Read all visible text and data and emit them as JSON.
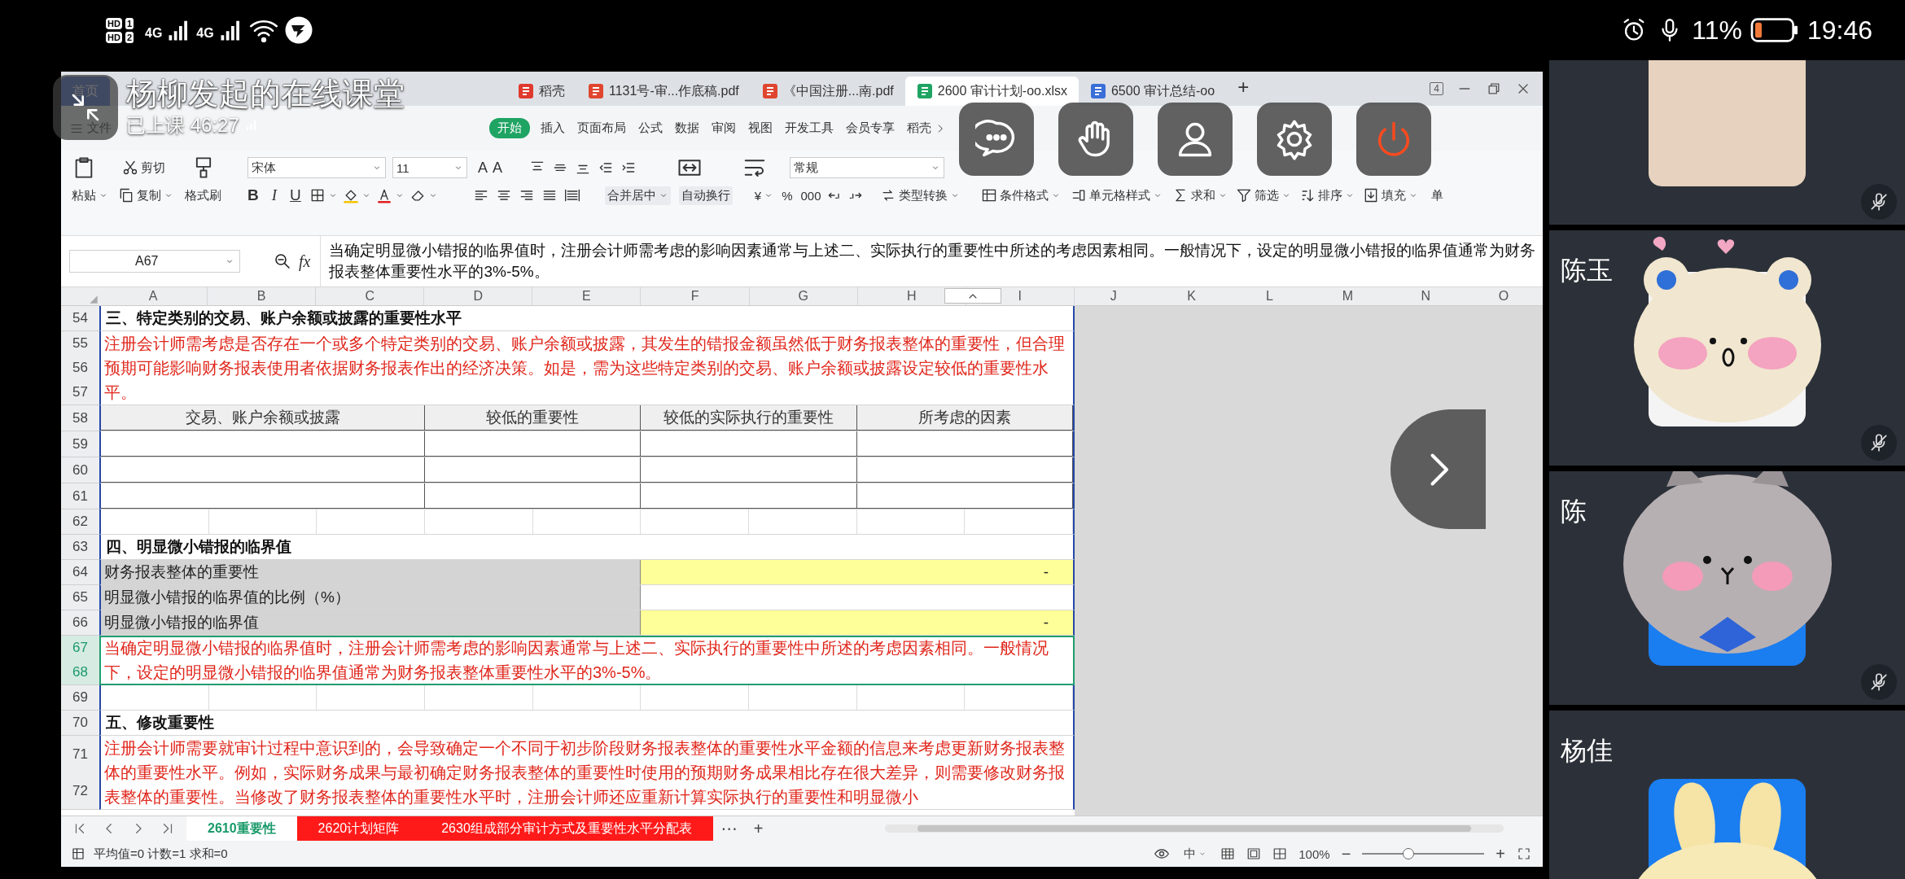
{
  "phone_status": {
    "sims": [
      {
        "label": "HD",
        "slot": "1"
      },
      {
        "label": "HD",
        "slot": "2"
      }
    ],
    "networks": [
      {
        "label": "4G"
      },
      {
        "label": "4G"
      }
    ],
    "battery": "11%",
    "time": "19:46"
  },
  "class_overlay": {
    "title": "杨柳发起的在线课堂",
    "timer": "已上课 46:27"
  },
  "overlay_buttons": [
    {
      "kind": "chat"
    },
    {
      "kind": "raise_hand"
    },
    {
      "kind": "profile"
    },
    {
      "kind": "settings"
    },
    {
      "kind": "leave"
    }
  ],
  "app_tabs": [
    {
      "label": "首页",
      "kind": "home",
      "selected": false
    },
    {
      "label": "稻壳",
      "kind": "docer",
      "selected": false
    },
    {
      "label": "1131号-审...作底稿.pdf",
      "kind": "pdf",
      "selected": false
    },
    {
      "label": "《中国注册...南.pdf",
      "kind": "pdf",
      "selected": false
    },
    {
      "label": "2600 审计计划-oo.xlsx",
      "kind": "sheet",
      "selected": true
    },
    {
      "label": "6500 审计总结-oo",
      "kind": "doc",
      "selected": false
    }
  ],
  "new_tab": "+",
  "window_count": "4",
  "menu": [
    {
      "label": "文件",
      "kind": "file",
      "selected": false
    },
    {
      "label": "开始",
      "kind": "tab",
      "selected": true
    },
    {
      "label": "插入",
      "kind": "tab",
      "selected": false
    },
    {
      "label": "页面布局",
      "kind": "tab",
      "selected": false
    },
    {
      "label": "公式",
      "kind": "tab",
      "selected": false
    },
    {
      "label": "数据",
      "kind": "tab",
      "selected": false
    },
    {
      "label": "审阅",
      "kind": "tab",
      "selected": false
    },
    {
      "label": "视图",
      "kind": "tab",
      "selected": false
    },
    {
      "label": "开发工具",
      "kind": "tab",
      "selected": false
    },
    {
      "label": "会员专享",
      "kind": "tab",
      "selected": false
    },
    {
      "label": "稻壳",
      "kind": "more",
      "selected": false
    }
  ],
  "ribbon": {
    "cut": "剪切",
    "paste": "粘贴",
    "copy": "复制",
    "format_painter": "格式刷",
    "font": "宋体",
    "font_size": "11",
    "grow_font": "A",
    "shrink_font": "A",
    "bold": "B",
    "italic": "I",
    "underline": "U",
    "merge": "合并居中",
    "wrap": "自动换行",
    "number_format": "常规",
    "currency": "¥",
    "percent": "%",
    "thousands": "000",
    "convert": "类型转换",
    "conditional": "条件格式",
    "cell_style": "单元格样式",
    "sum": "求和",
    "filter": "筛选",
    "sort": "排序",
    "fill": "填充",
    "overflow": "单"
  },
  "formula_bar": {
    "cell": "A67",
    "fx": "fx",
    "formula": "当确定明显微小错报的临界值时，注册会计师需考虑的影响因素通常与上述二、实际执行的重要性中所述的考虑因素相同。一般情况下，设定的明显微小错报的临界值通常为财务报表整体重要性水平的3%-5%。"
  },
  "sheet": {
    "columns": [
      "A",
      "B",
      "C",
      "D",
      "E",
      "F",
      "G",
      "H",
      "I"
    ],
    "extra_columns": [
      "J",
      "K",
      "L",
      "M",
      "N",
      "O"
    ],
    "rows": [
      {
        "kind": "heading",
        "numbers": [
          "54"
        ],
        "selected": false,
        "text": "三、特定类别的交易、账户余额或披露的重要性水平"
      },
      {
        "kind": "note",
        "numbers": [
          "55",
          "56",
          "57"
        ],
        "selected": false,
        "text": "注册会计师需考虑是否存在一个或多个特定类别的交易、账户余额或披露，其发生的错报金额虽然低于财务报表整体的重要性，但合理预期可能影响财务报表使用者依据财务报表作出的经济决策。如是，需为这些特定类别的交易、账户余额或披露设定较低的重要性水平。"
      },
      {
        "kind": "table_header",
        "numbers": [
          "58"
        ],
        "selected": false,
        "cells": [
          "交易、账户余额或披露",
          "较低的重要性",
          "较低的实际执行的重要性",
          "所考虑的因素"
        ]
      },
      {
        "kind": "table_row",
        "numbers": [
          "59"
        ],
        "selected": false
      },
      {
        "kind": "table_row",
        "numbers": [
          "60"
        ],
        "selected": false
      },
      {
        "kind": "table_row",
        "numbers": [
          "61"
        ],
        "selected": false
      },
      {
        "kind": "blank",
        "numbers": [
          "62"
        ],
        "selected": false
      },
      {
        "kind": "heading",
        "numbers": [
          "63"
        ],
        "selected": false,
        "text": "四、明显微小错报的临界值"
      },
      {
        "kind": "field",
        "numbers": [
          "64"
        ],
        "selected": false,
        "label": "财务报表整体的重要性",
        "value": "-",
        "highlight": true
      },
      {
        "kind": "field",
        "numbers": [
          "65"
        ],
        "selected": false,
        "label": "明显微小错报的临界值的比例（%）",
        "highlight": false
      },
      {
        "kind": "field",
        "numbers": [
          "66"
        ],
        "selected": false,
        "label": "明显微小错报的临界值",
        "value": "-",
        "highlight": true
      },
      {
        "kind": "note",
        "numbers": [
          "67",
          "68"
        ],
        "selected": true,
        "text": "当确定明显微小错报的临界值时，注册会计师需考虑的影响因素通常与上述二、实际执行的重要性中所述的考虑因素相同。一般情况下，设定的明显微小错报的临界值通常为财务报表整体重要性水平的3%-5%。"
      },
      {
        "kind": "blank",
        "numbers": [
          "69"
        ],
        "selected": false
      },
      {
        "kind": "heading",
        "numbers": [
          "70"
        ],
        "selected": false,
        "text": "五、修改重要性"
      },
      {
        "kind": "note",
        "numbers": [
          "71",
          "72"
        ],
        "selected": false,
        "text": "注册会计师需要就审计过程中意识到的，会导致确定一个不同于初步阶段财务报表整体的重要性水平金额的信息来考虑更新财务报表整体的重要性水平。例如，实际财务成果与最初确定财务报表整体的重要性时使用的预期财务成果相比存在很大差异，则需要修改财务报表整体的重要性。当修改了财务报表整体的重要性水平时，注册会计师还应重新计算实际执行的重要性和明显微小"
      }
    ]
  },
  "sheet_tabs": [
    {
      "label": "2610重要性",
      "selected": true
    },
    {
      "label": "2620计划矩阵",
      "selected": false,
      "color": "#ff1a1a"
    },
    {
      "label": "2630组成部分审计方式及重要性水平分配表",
      "selected": false,
      "color": "#ff1a1a"
    }
  ],
  "more_tabs": "⋯",
  "add_sheet": "+",
  "status_bar": {
    "summary": "平均值=0 计数=1 求和=0",
    "ime": "中",
    "zoom": "100%",
    "zoom_out": "−",
    "zoom_in": "+",
    "zoom_slider": {
      "level": 0.38
    }
  },
  "participants": [
    {
      "kind": "photo",
      "muted": true
    },
    {
      "kind": "avatar",
      "name": "陈玉",
      "color": "#f4f4f4",
      "sticker": {
        "kind": "bear"
      },
      "muted": true
    },
    {
      "kind": "avatar",
      "name": "陈",
      "color": "#1a7df0",
      "sticker": {
        "kind": "cat"
      },
      "muted": true
    },
    {
      "kind": "avatar",
      "name": "杨佳",
      "color": "#1a7df0",
      "sticker": {
        "kind": "rabbit"
      },
      "muted": false
    }
  ]
}
